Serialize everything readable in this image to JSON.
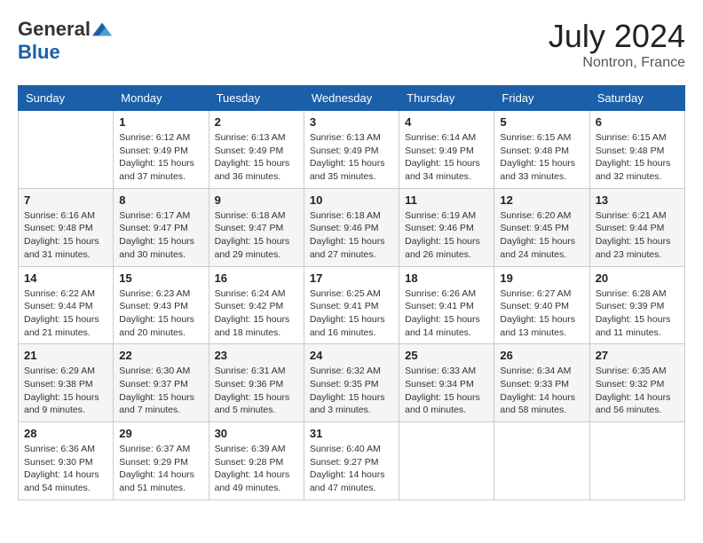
{
  "header": {
    "logo_general": "General",
    "logo_blue": "Blue",
    "month_year": "July 2024",
    "location": "Nontron, France"
  },
  "calendar": {
    "days_of_week": [
      "Sunday",
      "Monday",
      "Tuesday",
      "Wednesday",
      "Thursday",
      "Friday",
      "Saturday"
    ],
    "weeks": [
      [
        {
          "day": "",
          "info": ""
        },
        {
          "day": "1",
          "info": "Sunrise: 6:12 AM\nSunset: 9:49 PM\nDaylight: 15 hours\nand 37 minutes."
        },
        {
          "day": "2",
          "info": "Sunrise: 6:13 AM\nSunset: 9:49 PM\nDaylight: 15 hours\nand 36 minutes."
        },
        {
          "day": "3",
          "info": "Sunrise: 6:13 AM\nSunset: 9:49 PM\nDaylight: 15 hours\nand 35 minutes."
        },
        {
          "day": "4",
          "info": "Sunrise: 6:14 AM\nSunset: 9:49 PM\nDaylight: 15 hours\nand 34 minutes."
        },
        {
          "day": "5",
          "info": "Sunrise: 6:15 AM\nSunset: 9:48 PM\nDaylight: 15 hours\nand 33 minutes."
        },
        {
          "day": "6",
          "info": "Sunrise: 6:15 AM\nSunset: 9:48 PM\nDaylight: 15 hours\nand 32 minutes."
        }
      ],
      [
        {
          "day": "7",
          "info": "Sunrise: 6:16 AM\nSunset: 9:48 PM\nDaylight: 15 hours\nand 31 minutes."
        },
        {
          "day": "8",
          "info": "Sunrise: 6:17 AM\nSunset: 9:47 PM\nDaylight: 15 hours\nand 30 minutes."
        },
        {
          "day": "9",
          "info": "Sunrise: 6:18 AM\nSunset: 9:47 PM\nDaylight: 15 hours\nand 29 minutes."
        },
        {
          "day": "10",
          "info": "Sunrise: 6:18 AM\nSunset: 9:46 PM\nDaylight: 15 hours\nand 27 minutes."
        },
        {
          "day": "11",
          "info": "Sunrise: 6:19 AM\nSunset: 9:46 PM\nDaylight: 15 hours\nand 26 minutes."
        },
        {
          "day": "12",
          "info": "Sunrise: 6:20 AM\nSunset: 9:45 PM\nDaylight: 15 hours\nand 24 minutes."
        },
        {
          "day": "13",
          "info": "Sunrise: 6:21 AM\nSunset: 9:44 PM\nDaylight: 15 hours\nand 23 minutes."
        }
      ],
      [
        {
          "day": "14",
          "info": "Sunrise: 6:22 AM\nSunset: 9:44 PM\nDaylight: 15 hours\nand 21 minutes."
        },
        {
          "day": "15",
          "info": "Sunrise: 6:23 AM\nSunset: 9:43 PM\nDaylight: 15 hours\nand 20 minutes."
        },
        {
          "day": "16",
          "info": "Sunrise: 6:24 AM\nSunset: 9:42 PM\nDaylight: 15 hours\nand 18 minutes."
        },
        {
          "day": "17",
          "info": "Sunrise: 6:25 AM\nSunset: 9:41 PM\nDaylight: 15 hours\nand 16 minutes."
        },
        {
          "day": "18",
          "info": "Sunrise: 6:26 AM\nSunset: 9:41 PM\nDaylight: 15 hours\nand 14 minutes."
        },
        {
          "day": "19",
          "info": "Sunrise: 6:27 AM\nSunset: 9:40 PM\nDaylight: 15 hours\nand 13 minutes."
        },
        {
          "day": "20",
          "info": "Sunrise: 6:28 AM\nSunset: 9:39 PM\nDaylight: 15 hours\nand 11 minutes."
        }
      ],
      [
        {
          "day": "21",
          "info": "Sunrise: 6:29 AM\nSunset: 9:38 PM\nDaylight: 15 hours\nand 9 minutes."
        },
        {
          "day": "22",
          "info": "Sunrise: 6:30 AM\nSunset: 9:37 PM\nDaylight: 15 hours\nand 7 minutes."
        },
        {
          "day": "23",
          "info": "Sunrise: 6:31 AM\nSunset: 9:36 PM\nDaylight: 15 hours\nand 5 minutes."
        },
        {
          "day": "24",
          "info": "Sunrise: 6:32 AM\nSunset: 9:35 PM\nDaylight: 15 hours\nand 3 minutes."
        },
        {
          "day": "25",
          "info": "Sunrise: 6:33 AM\nSunset: 9:34 PM\nDaylight: 15 hours\nand 0 minutes."
        },
        {
          "day": "26",
          "info": "Sunrise: 6:34 AM\nSunset: 9:33 PM\nDaylight: 14 hours\nand 58 minutes."
        },
        {
          "day": "27",
          "info": "Sunrise: 6:35 AM\nSunset: 9:32 PM\nDaylight: 14 hours\nand 56 minutes."
        }
      ],
      [
        {
          "day": "28",
          "info": "Sunrise: 6:36 AM\nSunset: 9:30 PM\nDaylight: 14 hours\nand 54 minutes."
        },
        {
          "day": "29",
          "info": "Sunrise: 6:37 AM\nSunset: 9:29 PM\nDaylight: 14 hours\nand 51 minutes."
        },
        {
          "day": "30",
          "info": "Sunrise: 6:39 AM\nSunset: 9:28 PM\nDaylight: 14 hours\nand 49 minutes."
        },
        {
          "day": "31",
          "info": "Sunrise: 6:40 AM\nSunset: 9:27 PM\nDaylight: 14 hours\nand 47 minutes."
        },
        {
          "day": "",
          "info": ""
        },
        {
          "day": "",
          "info": ""
        },
        {
          "day": "",
          "info": ""
        }
      ]
    ]
  }
}
